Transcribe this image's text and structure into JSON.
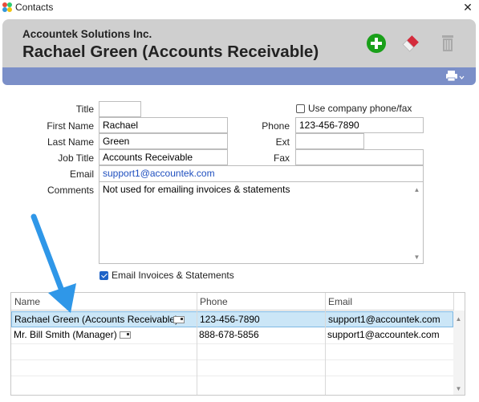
{
  "window": {
    "title": "Contacts",
    "close_glyph": "✕"
  },
  "header": {
    "company": "Accountek Solutions Inc.",
    "contact_title": "Rachael Green (Accounts Receivable)",
    "icons": [
      "add-icon",
      "eraser-icon",
      "trash-icon",
      "printer-icon"
    ],
    "colors": {
      "panel": "#cfcfcf",
      "band": "#7b8fc8",
      "add": "#1aa01a"
    }
  },
  "form": {
    "labels": {
      "title": "Title",
      "first_name": "First Name",
      "last_name": "Last Name",
      "job_title": "Job Title",
      "email": "Email",
      "comments": "Comments",
      "phone": "Phone",
      "ext": "Ext",
      "fax": "Fax",
      "use_company_phone": "Use company phone/fax",
      "email_invoices": "Email Invoices & Statements"
    },
    "values": {
      "title": "",
      "first_name": "Rachael",
      "last_name": "Green",
      "job_title": "Accounts Receivable",
      "email": "support1@accountek.com",
      "comments": "Not used for emailing invoices & statements",
      "phone": "123-456-7890",
      "ext": "",
      "fax": ""
    },
    "use_company_phone_checked": false,
    "email_invoices_checked": true
  },
  "table": {
    "columns": [
      "Name",
      "Phone",
      "Email"
    ],
    "rows": [
      {
        "name": "Rachael Green (Accounts Receivable)",
        "phone": "123-456-7890",
        "email": "support1@accountek.com",
        "selected": true
      },
      {
        "name": "Mr. Bill Smith (Manager)",
        "phone": "888-678-5856",
        "email": "support1@accountek.com",
        "selected": false
      }
    ]
  }
}
